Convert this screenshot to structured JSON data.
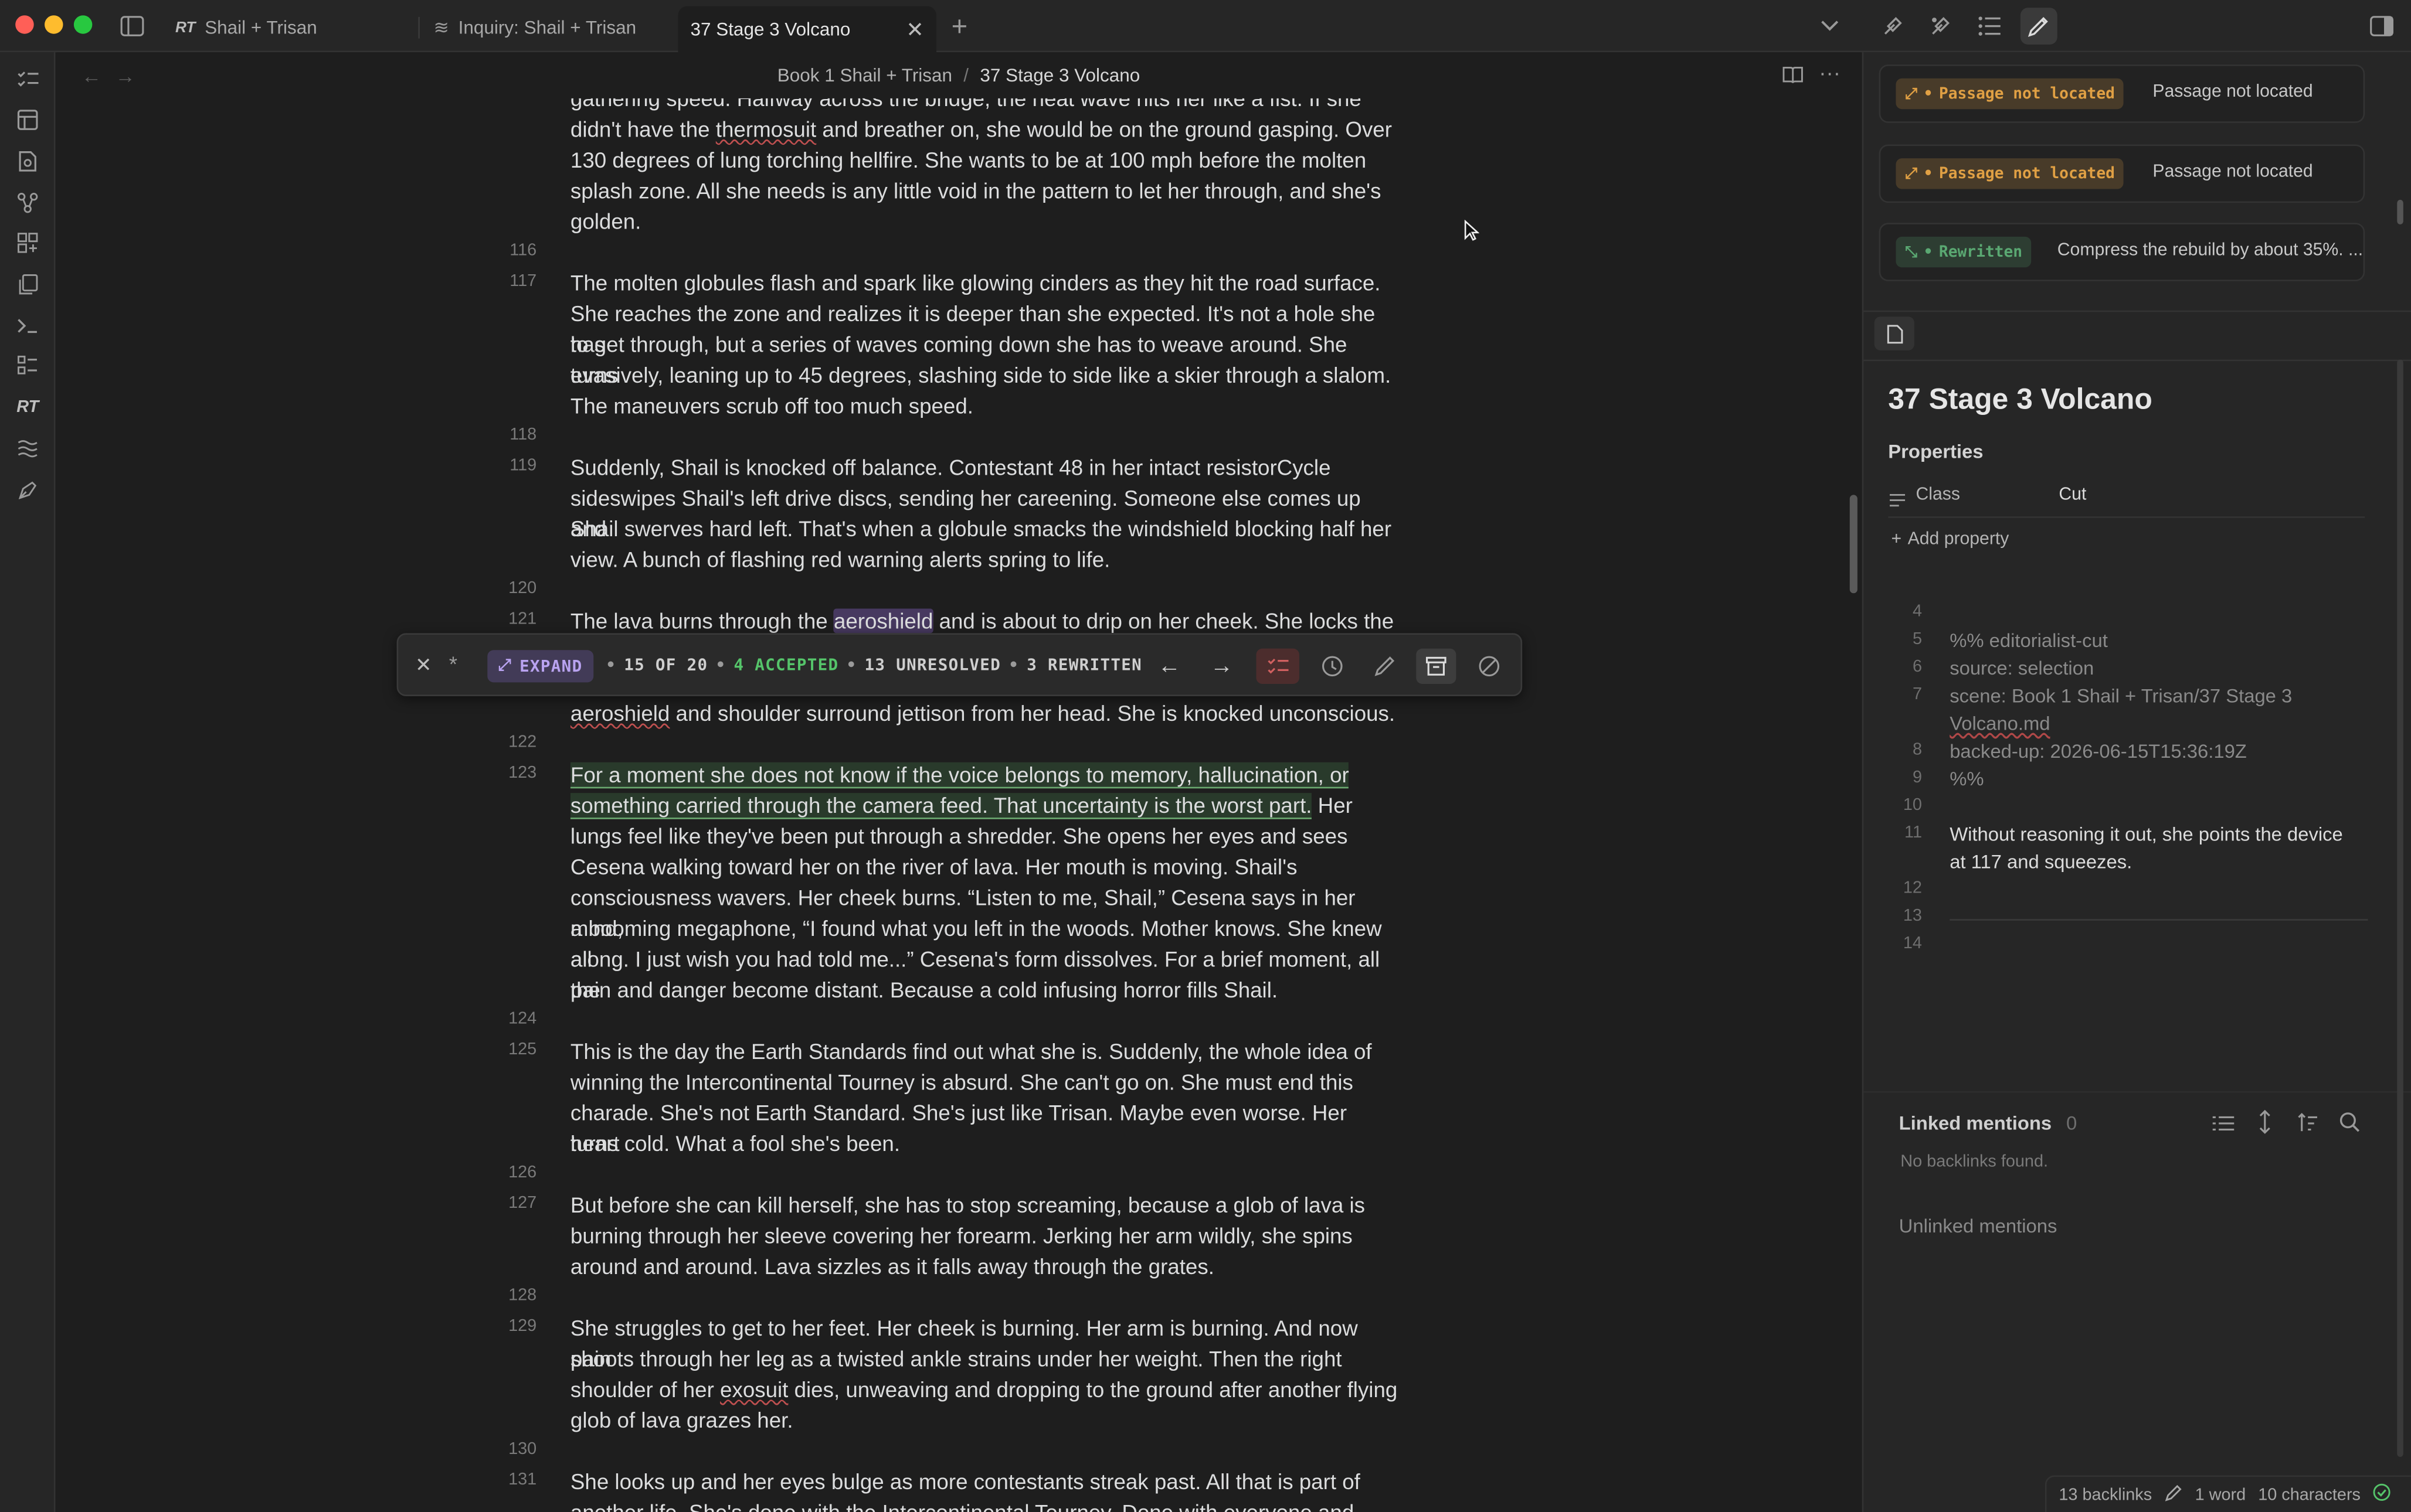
{
  "window": {
    "tabs": [
      {
        "label": "Shail + Trisan",
        "icon": "rt-logo-icon"
      },
      {
        "label": "Inquiry: Shail + Trisan",
        "icon": "inquiry-icon"
      },
      {
        "label": "37 Stage 3 Volcano",
        "icon": "",
        "active": true
      }
    ],
    "ribbon_logo": "RT",
    "colors": {
      "accent_purple": "#8c6ee0",
      "accepted_green": "#55c46a",
      "rewritten_green": "#5aa872",
      "warning_orange": "#e0a044"
    }
  },
  "breadcrumb": {
    "folder": "Book 1 Shail + Trisan",
    "separator": "/",
    "note": "37 Stage 3 Volcano"
  },
  "editor": {
    "lines": [
      {
        "num": "",
        "text": "gathering speed. Halfway across the bridge, the heat wave hits her like a fist. If she"
      },
      {
        "num": "",
        "text": "didn't have the thermosuit and breather on, she would be on the ground gasping. Over"
      },
      {
        "num": "",
        "text": "130 degrees of lung torching hellfire. She wants to be at 100 mph before the molten"
      },
      {
        "num": "",
        "text": "splash zone. All she needs is any little void in the pattern to let her through, and she's"
      },
      {
        "num": "",
        "text": "golden."
      },
      {
        "num": "116",
        "text": ""
      },
      {
        "num": "117",
        "text": "The molten globules flash and spark like glowing cinders as they hit the road surface."
      },
      {
        "num": "",
        "text": "She reaches the zone and realizes it is deeper than she expected. It's not a hole she has"
      },
      {
        "num": "",
        "text": "to get through, but a series of waves coming down she has to weave around. She turns"
      },
      {
        "num": "",
        "text": "evasively, leaning up to 45 degrees, slashing side to side like a skier through a slalom."
      },
      {
        "num": "",
        "text": "The maneuvers scrub off too much speed."
      },
      {
        "num": "118",
        "text": ""
      },
      {
        "num": "119",
        "text": "Suddenly, Shail is knocked off balance. Contestant 48 in her intact resistorCycle"
      },
      {
        "num": "",
        "text": "sideswipes Shail's left drive discs, sending her careening. Someone else comes up and"
      },
      {
        "num": "",
        "text": "Shail swerves hard left. That's when a globule smacks the windshield blocking half her"
      },
      {
        "num": "",
        "text": "view. A bunch of flashing red warning alerts spring to life."
      },
      {
        "num": "120",
        "text": ""
      },
      {
        "num": "121",
        "text": "The lava burns through the aeroshield and is about to drip on her cheek. She locks the"
      },
      {
        "num": "",
        "text": "aeroshield and shoulder surround jettison from her head. She is knocked unconscious."
      },
      {
        "num": "122",
        "text": ""
      },
      {
        "num": "123",
        "text": "For a moment she does not know if the voice belongs to memory, hallucination, or"
      },
      {
        "num": "",
        "text": "something carried through the camera feed. That uncertainty is the worst part. Her"
      },
      {
        "num": "",
        "text": "lungs feel like they've been put through a shredder. She opens her eyes and sees"
      },
      {
        "num": "",
        "text": "Cesena walking toward her on the river of lava. Her mouth is moving. Shail's"
      },
      {
        "num": "",
        "text": "consciousness wavers. Her cheek burns. “Listen to me, Shail,” Cesena says in her mind,"
      },
      {
        "num": "",
        "text": "a booming megaphone, “I found what you left in the woods. Mother knows. She knew all"
      },
      {
        "num": "",
        "text": "along. I just wish you had told me...” Cesena's form dissolves. For a brief moment, all the"
      },
      {
        "num": "",
        "text": "pain and danger become distant. Because a cold infusing horror fills Shail."
      },
      {
        "num": "124",
        "text": ""
      },
      {
        "num": "125",
        "text": "This is the day the Earth Standards find out what she is. Suddenly, the whole idea of"
      },
      {
        "num": "",
        "text": "winning the Intercontinental Tourney is absurd. She can't go on. She must end this"
      },
      {
        "num": "",
        "text": "charade. She's not Earth Standard. She's just like Trisan. Maybe even worse. Her heart"
      },
      {
        "num": "",
        "text": "turns cold. What a fool she's been."
      },
      {
        "num": "126",
        "text": ""
      },
      {
        "num": "127",
        "text": "But before she can kill herself, she has to stop screaming, because a glob of lava is"
      },
      {
        "num": "",
        "text": "burning through her sleeve covering her forearm. Jerking her arm wildly, she spins"
      },
      {
        "num": "",
        "text": "around and around. Lava sizzles as it falls away through the grates."
      },
      {
        "num": "128",
        "text": ""
      },
      {
        "num": "129",
        "text": "She struggles to get to her feet. Her cheek is burning. Her arm is burning. And now pain"
      },
      {
        "num": "",
        "text": "shoots through her leg as a twisted ankle strains under her weight. Then the right"
      },
      {
        "num": "",
        "text": "shoulder of her exosuit dies, unweaving and dropping to the ground after another flying"
      },
      {
        "num": "",
        "text": "glob of lava grazes her."
      },
      {
        "num": "130",
        "text": ""
      },
      {
        "num": "131",
        "text": "She looks up and her eyes bulge as more contestants streak past. All that is part of"
      },
      {
        "num": "",
        "text": "another life. She's done with the Intercontinental Tourney. Done with everyone and"
      }
    ]
  },
  "float_toolbar": {
    "expand_label": "EXPAND",
    "position": "15 OF 20",
    "accepted": "4 ACCEPTED",
    "unresolved": "13 UNRESOLVED",
    "rewritten": "3 REWRITTEN",
    "dot": "•",
    "star": "*"
  },
  "sidebar": {
    "cards": [
      {
        "badge": "Passage not located",
        "text": "Passage not located",
        "kind": "warning"
      },
      {
        "badge": "Passage not located",
        "text": "Passage not located",
        "kind": "warning"
      },
      {
        "badge": "Rewritten",
        "text": "Compress the rebuild by about 35%. ...",
        "kind": "rewritten"
      }
    ],
    "note_title": "37 Stage 3 Volcano",
    "properties_label": "Properties",
    "property": {
      "key": "Class",
      "value": "Cut"
    },
    "add_property": "Add property",
    "frontmatter": [
      {
        "num": "4",
        "text": ""
      },
      {
        "num": "5",
        "text": "%% editorialist-cut"
      },
      {
        "num": "6",
        "text": "source: selection"
      },
      {
        "num": "7",
        "text": "scene: Book 1 Shail + Trisan/37 Stage 3"
      },
      {
        "num": "",
        "text": "Volcano.md"
      },
      {
        "num": "8",
        "text": "backed-up: 2026-06-15T15:36:19Z"
      },
      {
        "num": "9",
        "text": "%%"
      },
      {
        "num": "10",
        "text": ""
      },
      {
        "num": "11",
        "text": "Without reasoning it out, she points the device"
      },
      {
        "num": "",
        "text": "at 117 and squeezes."
      },
      {
        "num": "12",
        "text": ""
      },
      {
        "num": "13",
        "text": ""
      },
      {
        "num": "14",
        "text": ""
      }
    ],
    "linked_mentions": "Linked mentions",
    "linked_count": "0",
    "no_backlinks": "No backlinks found.",
    "unlinked_mentions": "Unlinked mentions"
  },
  "status": {
    "backlinks": "13 backlinks",
    "words": "1 word",
    "chars": "10 characters"
  }
}
